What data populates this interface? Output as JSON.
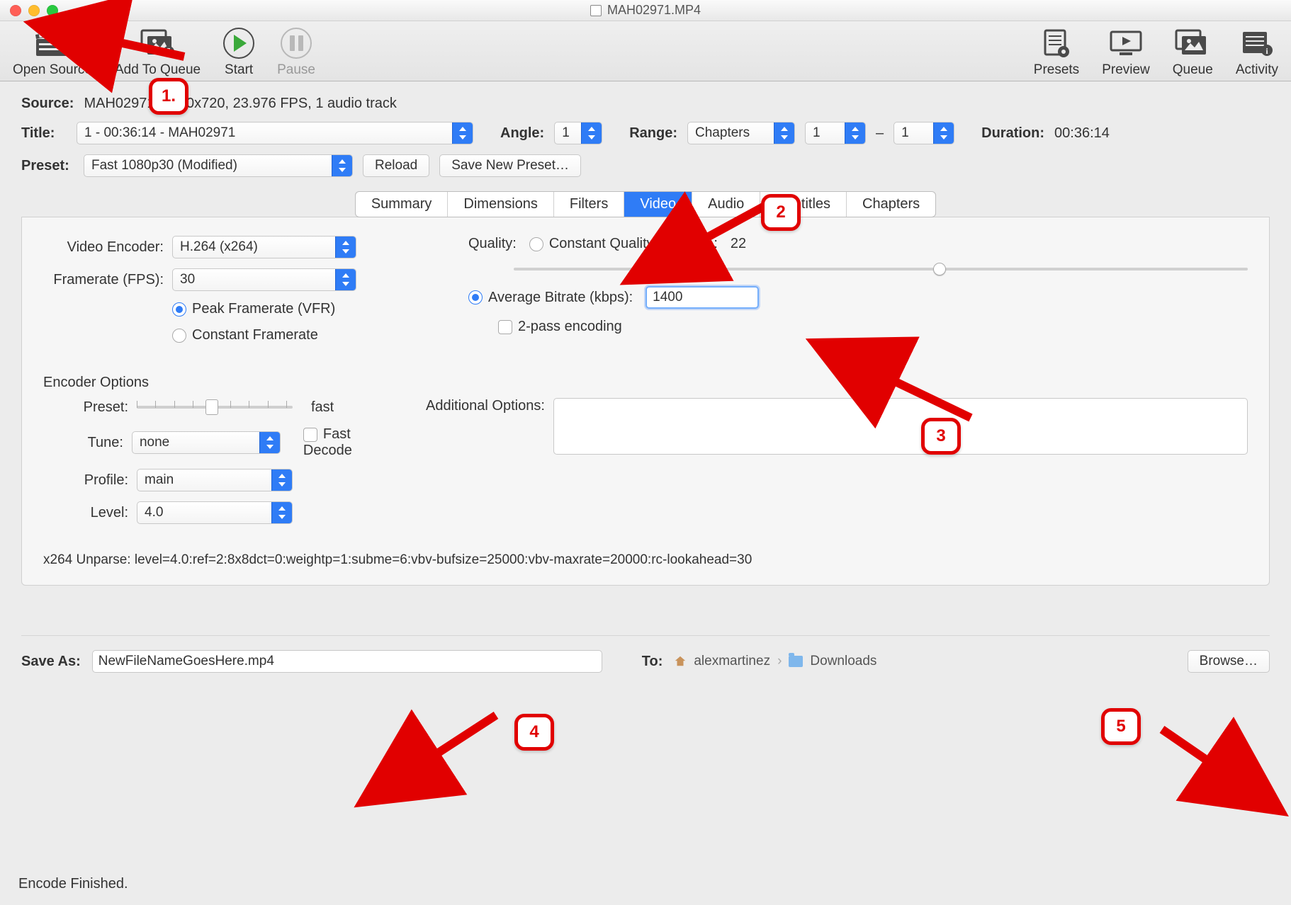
{
  "titlebar": {
    "filename": "MAH02971.MP4"
  },
  "toolbar": {
    "open_source": "Open Source",
    "add_to_queue": "Add To Queue",
    "start": "Start",
    "pause": "Pause",
    "presets": "Presets",
    "preview": "Preview",
    "queue": "Queue",
    "activity": "Activity"
  },
  "source": {
    "label": "Source:",
    "value": "MAH02971, 1280x720, 23.976 FPS, 1 audio track"
  },
  "title_row": {
    "label": "Title:",
    "value": "1 - 00:36:14 - MAH02971",
    "angle_label": "Angle:",
    "angle": "1",
    "range_label": "Range:",
    "range_mode": "Chapters",
    "range_from": "1",
    "range_dash": "–",
    "range_to": "1",
    "duration_label": "Duration:",
    "duration": "00:36:14"
  },
  "preset_row": {
    "label": "Preset:",
    "value": "Fast 1080p30 (Modified)",
    "reload": "Reload",
    "save_new": "Save New Preset…"
  },
  "tabs": [
    "Summary",
    "Dimensions",
    "Filters",
    "Video",
    "Audio",
    "Subtitles",
    "Chapters"
  ],
  "active_tab": "Video",
  "video": {
    "encoder_label": "Video Encoder:",
    "encoder": "H.264 (x264)",
    "fps_label": "Framerate (FPS):",
    "fps": "30",
    "peak_vfr": "Peak Framerate (VFR)",
    "constant_fr": "Constant Framerate",
    "quality_label": "Quality:",
    "constant_quality": "Constant Quality",
    "rf_label": "RF:",
    "rf_value": "22",
    "avg_bitrate_label": "Average Bitrate (kbps):",
    "avg_bitrate": "1400",
    "two_pass": "2-pass encoding"
  },
  "encoder_options": {
    "heading": "Encoder Options",
    "preset_label": "Preset:",
    "preset_value": "fast",
    "tune_label": "Tune:",
    "tune": "none",
    "fast_decode": "Fast Decode",
    "profile_label": "Profile:",
    "profile": "main",
    "additional_label": "Additional Options:",
    "level_label": "Level:",
    "level": "4.0",
    "unparse": "x264 Unparse: level=4.0:ref=2:8x8dct=0:weightp=1:subme=6:vbv-bufsize=25000:vbv-maxrate=20000:rc-lookahead=30"
  },
  "save": {
    "label": "Save As:",
    "value": "NewFileNameGoesHere.mp4",
    "to_label": "To:",
    "path_user": "alexmartinez",
    "path_folder": "Downloads",
    "browse": "Browse…"
  },
  "status": "Encode Finished.",
  "annotations": {
    "b1": "1.",
    "b2": "2",
    "b3": "3",
    "b4": "4",
    "b5": "5"
  }
}
